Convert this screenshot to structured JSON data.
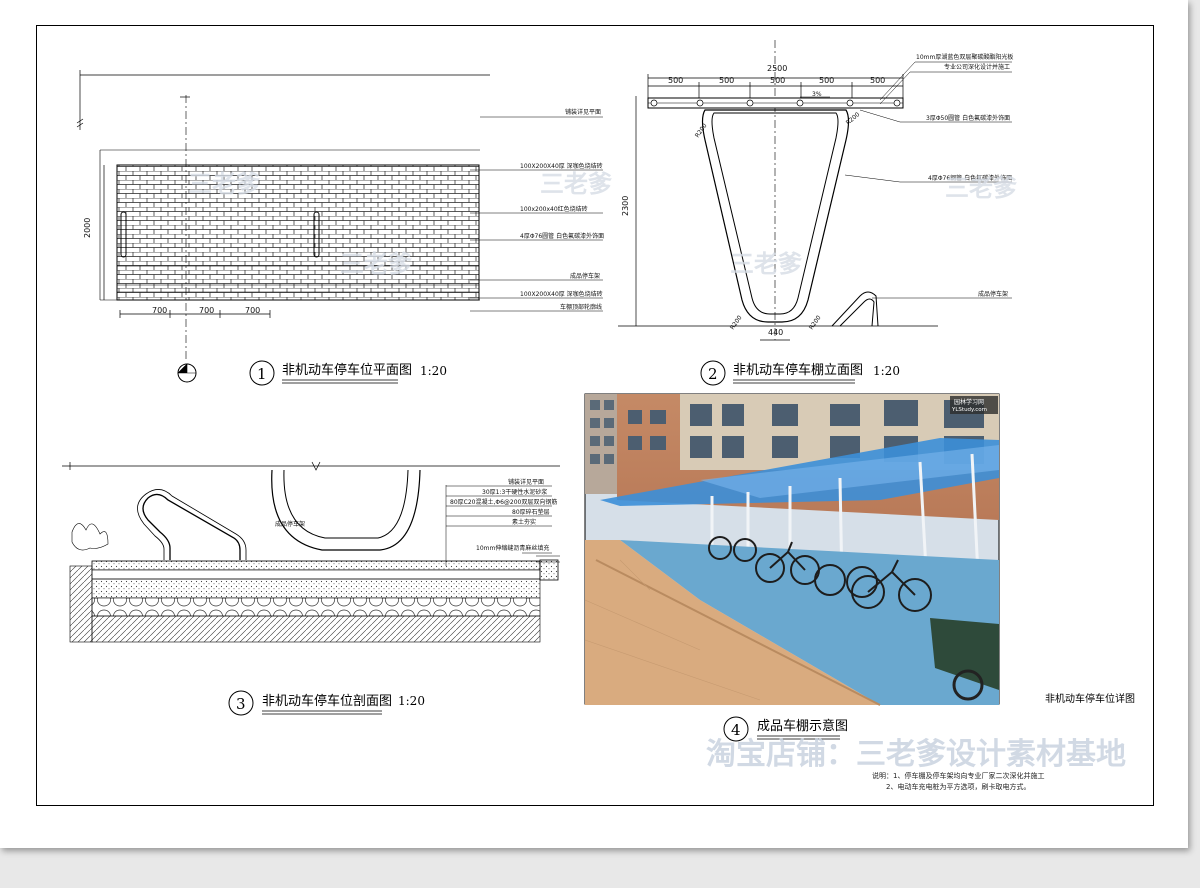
{
  "sheet": {
    "title": "非机动车停车位详图",
    "shop_watermark": "淘宝店铺：三老爹设计素材基地",
    "logo_watermark": "三老爹",
    "notes": [
      "说明：1、停车棚及停车架均向专业厂家二次深化并施工",
      "2、电动车充电桩为平方选项，刷卡取电方式。"
    ]
  },
  "views": [
    {
      "num": "1",
      "title": "非机动车停车位平面图",
      "scale": "1:20"
    },
    {
      "num": "2",
      "title": "非机动车停车棚立面图",
      "scale": "1:20"
    },
    {
      "num": "3",
      "title": "非机动车停车位剖面图",
      "scale": "1:20"
    },
    {
      "num": "4",
      "title": "成品车棚示意图",
      "scale": ""
    }
  ],
  "plan": {
    "dims_bottom": [
      "700",
      "700",
      "700"
    ],
    "dim_left": "2000",
    "labels": [
      "铺装详见平面",
      "100X200X40厚 深咖色烧结砖",
      "100x200x40红色烧结砖",
      "4厚Φ76圆管 白色氟碳漆外饰面",
      "成品停车架",
      "100X200X40厚 深咖色烧结砖",
      "车棚顶部轮廓线"
    ]
  },
  "elevation": {
    "dims_top": [
      "500",
      "500",
      "500",
      "500",
      "500"
    ],
    "dim_total": "2500",
    "dim_height": "2300",
    "dim_base": "440",
    "slope": "3%",
    "radius_labels": [
      "R200",
      "R200",
      "R200",
      "R200"
    ],
    "labels": [
      "10mm厚湖蓝色双层聚碳酸酯阳光板",
      "专业公司深化设计并施工",
      "3厚Φ50圆管 白色氟碳漆外饰面",
      "4厚Φ76钢管 白色氟碳漆外饰面",
      "成品停车架"
    ]
  },
  "section": {
    "labels": [
      "铺装详见平面",
      "30厚1:3干硬性水泥砂浆",
      "80厚C20混凝土,Φ6@200双层双向钢筋",
      "80厚碎石垫层",
      "素土夯实",
      "成品停车架",
      "10mm伸缩缝沥青麻丝填充"
    ]
  },
  "photo": {
    "site_badge": "园林学习网",
    "site_url": "YLStudy.com"
  },
  "colors": {
    "canopy_blue": "#3c8fd8",
    "brick": "#c9a27a",
    "sky": "#d9e2ea"
  }
}
